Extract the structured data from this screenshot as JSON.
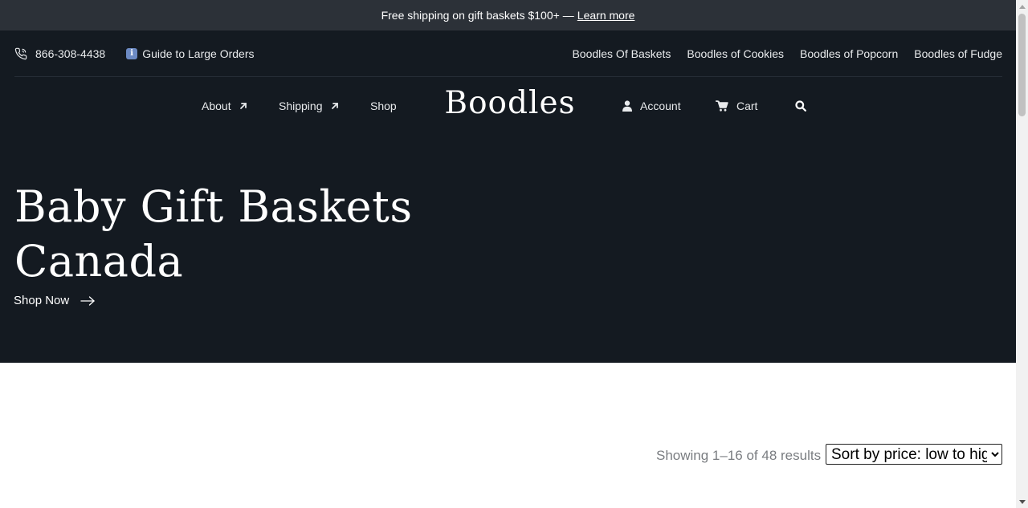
{
  "announcement": {
    "text": "Free shipping on gift baskets $100+",
    "separator": "—",
    "link": "Learn more"
  },
  "utility": {
    "phone": "866-308-4438",
    "guide": "Guide to Large Orders",
    "guide_icon": "info-icon",
    "links": [
      "Boodles Of Baskets",
      "Boodles of Cookies",
      "Boodles of Popcorn",
      "Boodles of Fudge"
    ]
  },
  "nav": {
    "about": "About",
    "shipping": "Shipping",
    "shop": "Shop",
    "logo": "Boodles",
    "account": "Account",
    "cart": "Cart"
  },
  "hero": {
    "title_line1": "Baby Gift Baskets",
    "title_line2": "Canada",
    "cta": "Shop Now"
  },
  "results": {
    "count_text": "Showing 1–16 of 48 results",
    "sort_selected": "Sort by price: low to high"
  },
  "colors": {
    "announce_bg": "#2c3138",
    "header_bg": "#141a21",
    "text_light": "#ffffff",
    "results_text": "#7a7d81"
  }
}
